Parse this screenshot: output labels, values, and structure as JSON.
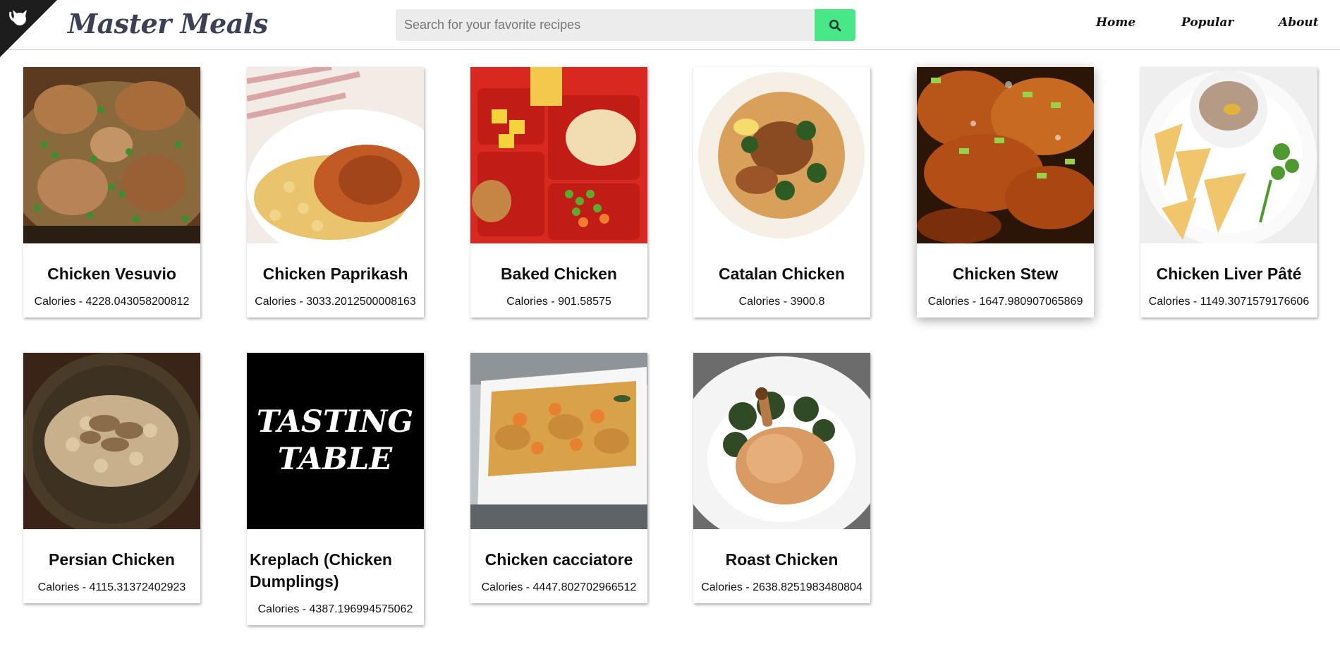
{
  "header": {
    "brand": "Master Meals",
    "search_placeholder": "Search for your favorite recipes",
    "search_value": "",
    "nav": {
      "home": "Home",
      "popular": "Popular",
      "about": "About"
    }
  },
  "colors": {
    "brand_text": "#3b4054",
    "search_button": "#48e889",
    "search_field": "#ececec",
    "corner": "#1d1d1d"
  },
  "icons": {
    "corner": "github-octocat-icon",
    "search": "search-icon"
  },
  "recipes": [
    {
      "title": "Chicken Vesuvio",
      "calories": "Calories - 4228.043058200812"
    },
    {
      "title": "Chicken Paprikash",
      "calories": "Calories - 3033.2012500008163"
    },
    {
      "title": "Baked Chicken",
      "calories": "Calories - 901.58575"
    },
    {
      "title": "Catalan Chicken",
      "calories": "Calories - 3900.8"
    },
    {
      "title": "Chicken Stew",
      "calories": "Calories - 1647.980907065869"
    },
    {
      "title": "Chicken Liver Pâté",
      "calories": "Calories - 1149.3071579176606"
    },
    {
      "title": "Persian Chicken",
      "calories": "Calories - 4115.31372402923"
    },
    {
      "title": "Kreplach (Chicken Dumplings)",
      "calories": "Calories - 4387.196994575062",
      "logo_text": "TASTING TABLE"
    },
    {
      "title": "Chicken cacciatore",
      "calories": "Calories - 4447.802702966512"
    },
    {
      "title": "Roast Chicken",
      "calories": "Calories - 2638.8251983480804"
    }
  ]
}
